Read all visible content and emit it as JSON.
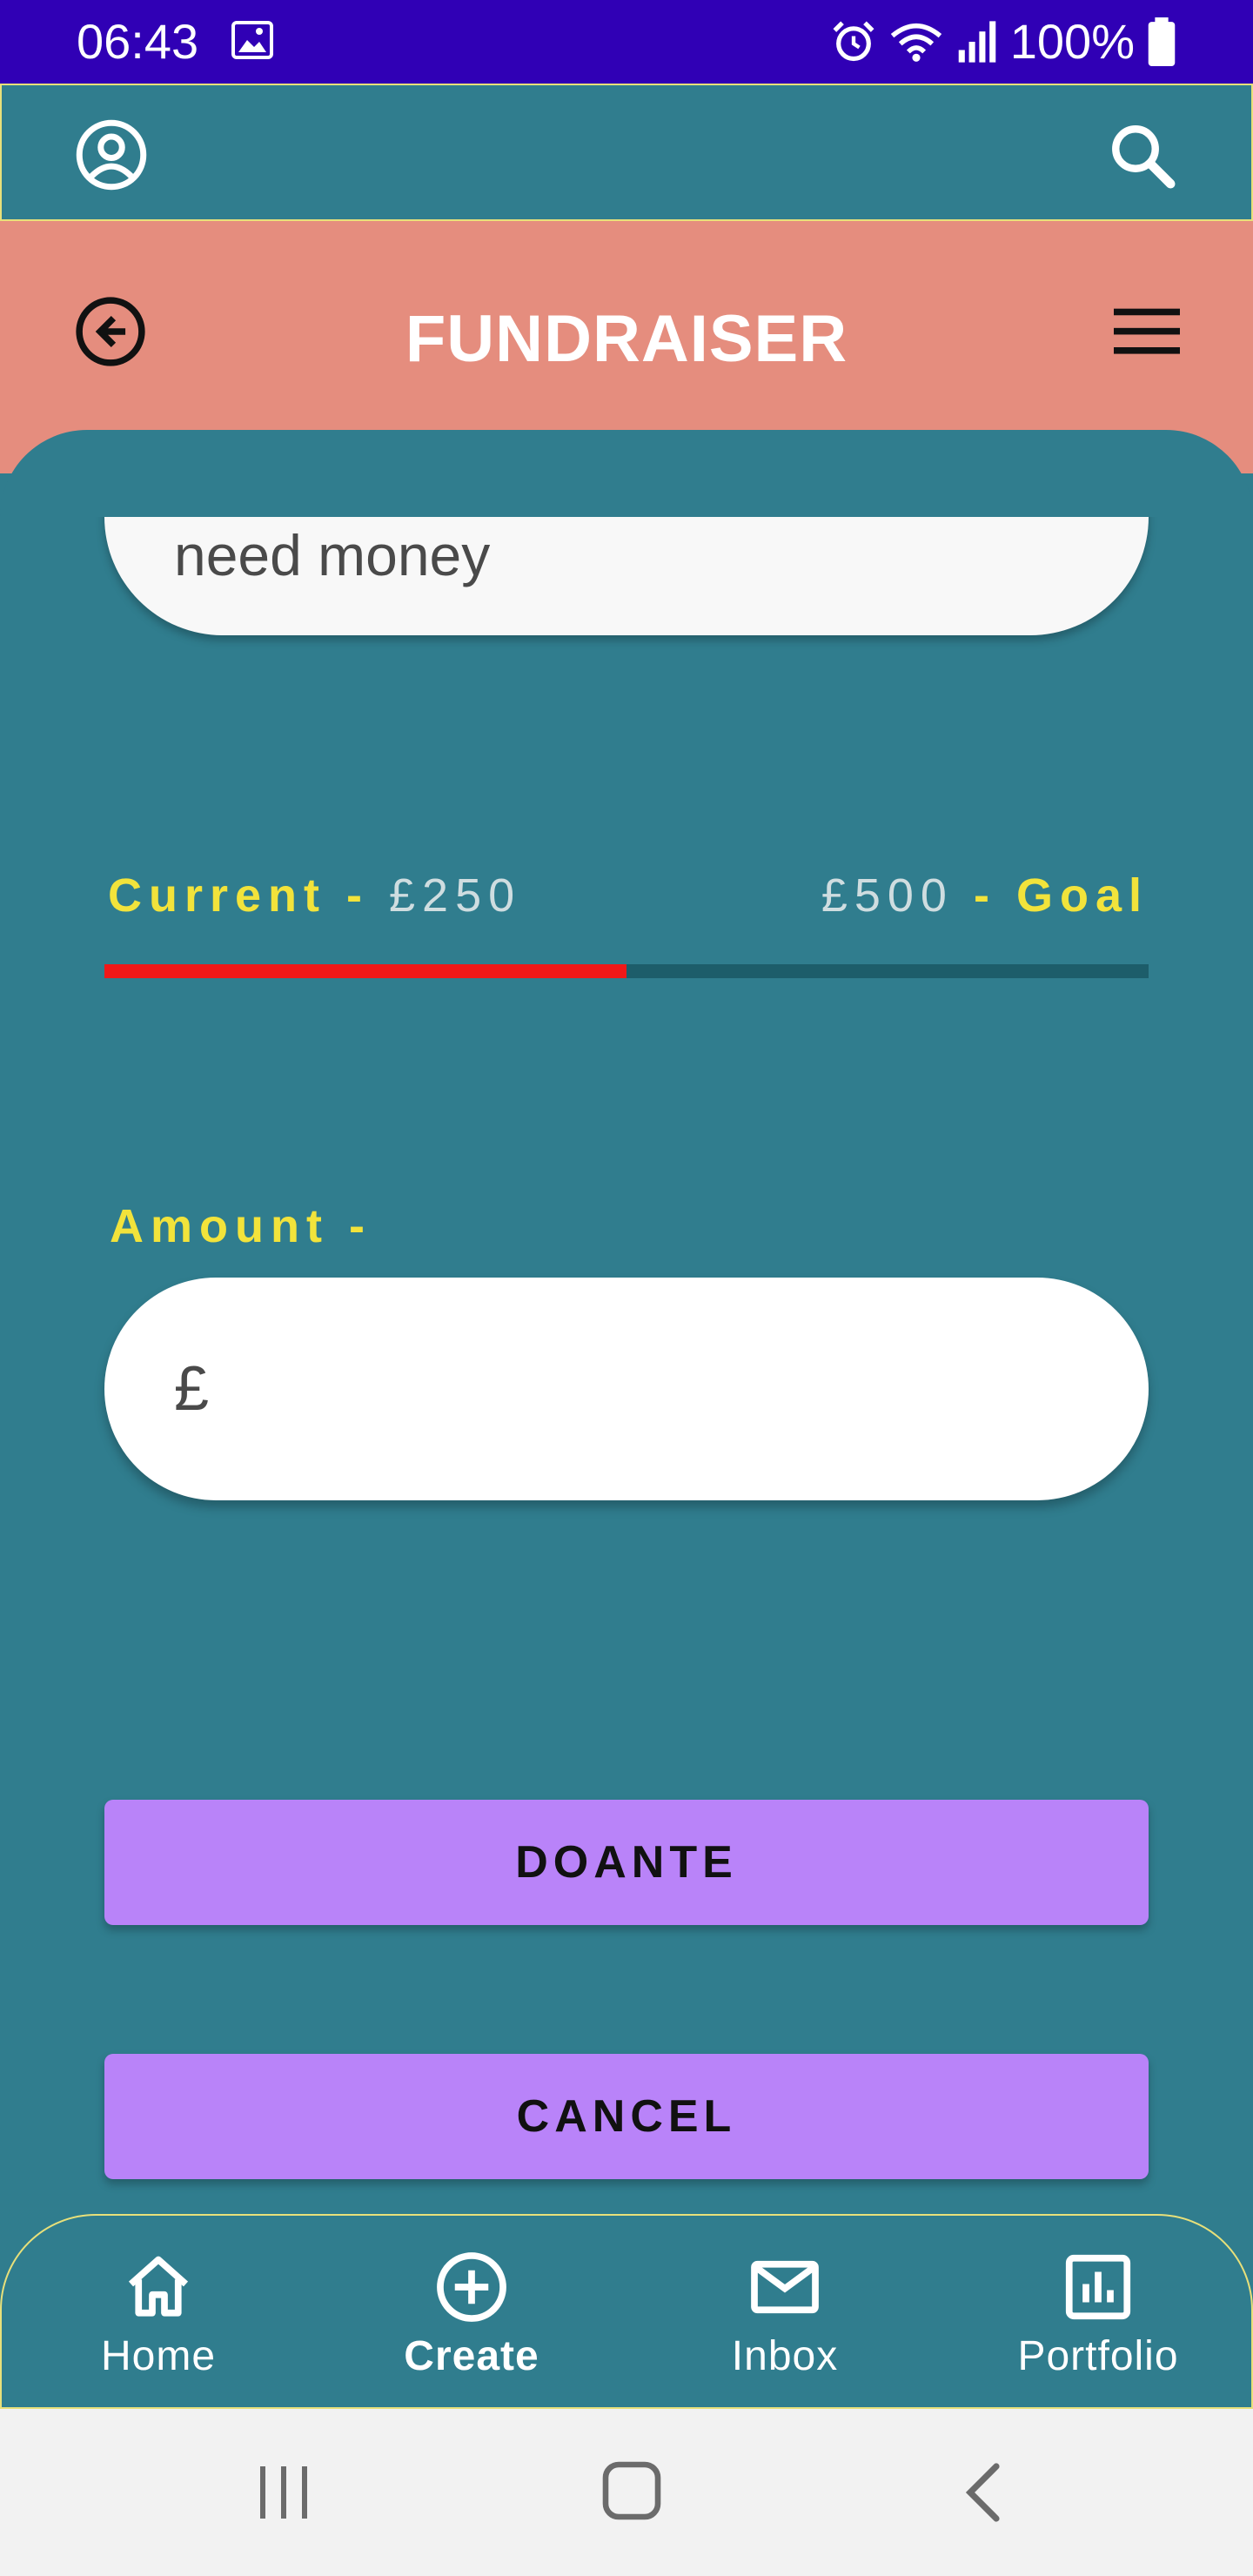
{
  "status_bar": {
    "time": "06:43",
    "battery": "100%",
    "icons": [
      "gallery-icon",
      "alarm-icon",
      "wifi-icon",
      "signal-icon",
      "battery-icon"
    ]
  },
  "app_bar": {
    "left_icon": "account-circle-icon",
    "right_icon": "search-icon"
  },
  "header": {
    "title": "FUNDRAISER",
    "left_icon": "back-circle-icon",
    "right_icon": "menu-icon"
  },
  "form": {
    "description_value": "need money",
    "progress": {
      "current_label": "Current -",
      "current_value": "£250",
      "goal_value": "£500",
      "goal_label": "- Goal",
      "fraction": 0.5
    },
    "amount_label": "Amount -",
    "amount_prefix": "£",
    "donate_label": "DOANTE",
    "cancel_label": "CANCEL"
  },
  "bottom_nav": {
    "items": [
      {
        "label": "Home",
        "icon": "home-icon",
        "active": false
      },
      {
        "label": "Create",
        "icon": "add-circle-icon",
        "active": true
      },
      {
        "label": "Inbox",
        "icon": "mail-icon",
        "active": false
      },
      {
        "label": "Portfolio",
        "icon": "chart-icon",
        "active": false
      }
    ]
  },
  "colors": {
    "status_bar": "#3000B5",
    "primary": "#307D8E",
    "header": "#E58D7E",
    "accent_yellow": "#F2E33B",
    "progress_fill": "#F01818",
    "button": "#B983F9"
  }
}
